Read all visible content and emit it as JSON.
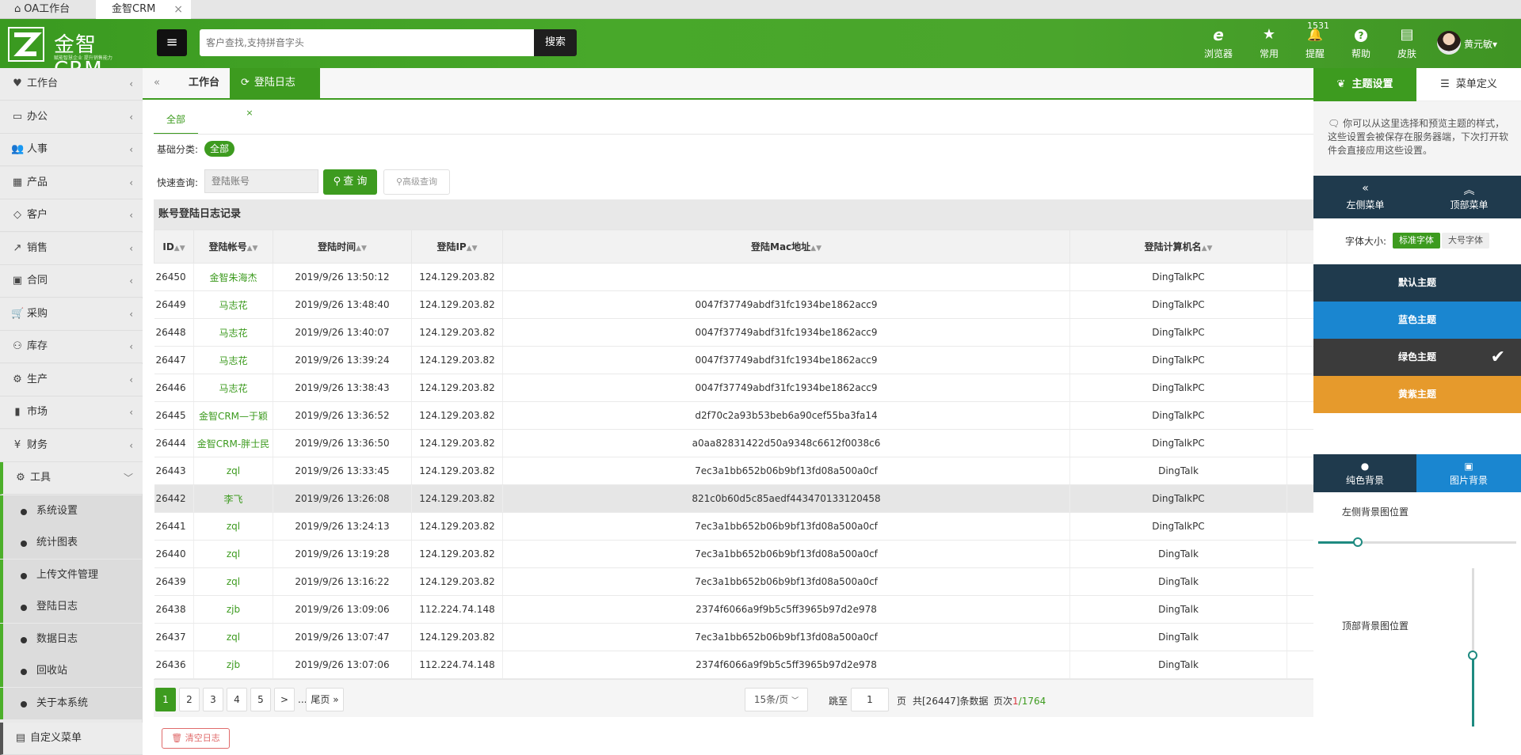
{
  "browser": {
    "tabs": [
      {
        "label": "OA工作台",
        "icon": "home-icon"
      },
      {
        "label": "金智CRM",
        "close": "×"
      }
    ]
  },
  "header": {
    "brand": "金智CRM",
    "slogan": "赋能智慧企业 提升销售能力",
    "search_placeholder": "客户查找,支持拼音字头",
    "search_button": "搜索",
    "icons": [
      {
        "name": "browser",
        "label": "浏览器",
        "glyph": "e"
      },
      {
        "name": "favorites",
        "label": "常用",
        "glyph": "★"
      },
      {
        "name": "reminder",
        "label": "提醒",
        "glyph": "🔔",
        "badge": "1531"
      },
      {
        "name": "help",
        "label": "帮助",
        "glyph": "?"
      },
      {
        "name": "skin",
        "label": "皮肤",
        "glyph": "▤"
      }
    ],
    "user": {
      "name": "黄元敏",
      "caret": "▾"
    }
  },
  "sidebar": {
    "items": [
      {
        "label": "工作台",
        "icon": "♥"
      },
      {
        "label": "办公",
        "icon": "▭"
      },
      {
        "label": "人事",
        "icon": "👥"
      },
      {
        "label": "产品",
        "icon": "▦"
      },
      {
        "label": "客户",
        "icon": "◇"
      },
      {
        "label": "销售",
        "icon": "↗"
      },
      {
        "label": "合同",
        "icon": "▣"
      },
      {
        "label": "采购",
        "icon": "🛒"
      },
      {
        "label": "库存",
        "icon": "⚇"
      },
      {
        "label": "生产",
        "icon": "⚙"
      },
      {
        "label": "市场",
        "icon": "▮"
      },
      {
        "label": "财务",
        "icon": "¥"
      },
      {
        "label": "工具",
        "icon": "⚙",
        "open": true
      }
    ],
    "subitems": [
      "系统设置",
      "统计图表",
      "上传文件管理",
      "登陆日志",
      "数据日志",
      "回收站",
      "关于本系统"
    ],
    "bottom": {
      "label": "自定义菜单",
      "icon": "▤"
    }
  },
  "pagetabs": {
    "back": "«",
    "tabs": [
      {
        "label": "工作台"
      },
      {
        "label": "登陆日志",
        "active": true,
        "refresh": "⟳",
        "close": "×"
      }
    ]
  },
  "filters": {
    "subtab": "全部",
    "category_label": "基础分类:",
    "category_value": "全部",
    "quick_label": "快速查询:",
    "quick_placeholder": "登陆账号",
    "query_button": "查 询",
    "advanced_button": "高级查询"
  },
  "table": {
    "title": "账号登陆日志记录",
    "columns": [
      "ID",
      "登陆帐号",
      "登陆时间",
      "登陆IP",
      "登陆Mac地址",
      "登陆计算机名"
    ],
    "rows": [
      [
        "26450",
        "金智朱海杰",
        "2019/9/26 13:50:12",
        "124.129.203.82",
        "",
        "DingTalkPC"
      ],
      [
        "26449",
        "马志花",
        "2019/9/26 13:48:40",
        "124.129.203.82",
        "0047f37749abdf31fc1934be1862acc9",
        "DingTalkPC"
      ],
      [
        "26448",
        "马志花",
        "2019/9/26 13:40:07",
        "124.129.203.82",
        "0047f37749abdf31fc1934be1862acc9",
        "DingTalkPC"
      ],
      [
        "26447",
        "马志花",
        "2019/9/26 13:39:24",
        "124.129.203.82",
        "0047f37749abdf31fc1934be1862acc9",
        "DingTalkPC"
      ],
      [
        "26446",
        "马志花",
        "2019/9/26 13:38:43",
        "124.129.203.82",
        "0047f37749abdf31fc1934be1862acc9",
        "DingTalkPC"
      ],
      [
        "26445",
        "金智CRM—于颖",
        "2019/9/26 13:36:52",
        "124.129.203.82",
        "d2f70c2a93b53beb6a90cef55ba3fa14",
        "DingTalkPC"
      ],
      [
        "26444",
        "金智CRM-胖士民",
        "2019/9/26 13:36:50",
        "124.129.203.82",
        "a0aa82831422d50a9348c6612f0038c6",
        "DingTalkPC"
      ],
      [
        "26443",
        "zql",
        "2019/9/26 13:33:45",
        "124.129.203.82",
        "7ec3a1bb652b06b9bf13fd08a500a0cf",
        "DingTalk"
      ],
      [
        "26442",
        "李飞",
        "2019/9/26 13:26:08",
        "124.129.203.82",
        "821c0b60d5c85aedf443470133120458",
        "DingTalkPC"
      ],
      [
        "26441",
        "zql",
        "2019/9/26 13:24:13",
        "124.129.203.82",
        "7ec3a1bb652b06b9bf13fd08a500a0cf",
        "DingTalkPC"
      ],
      [
        "26440",
        "zql",
        "2019/9/26 13:19:28",
        "124.129.203.82",
        "7ec3a1bb652b06b9bf13fd08a500a0cf",
        "DingTalk"
      ],
      [
        "26439",
        "zql",
        "2019/9/26 13:16:22",
        "124.129.203.82",
        "7ec3a1bb652b06b9bf13fd08a500a0cf",
        "DingTalk"
      ],
      [
        "26438",
        "zjb",
        "2019/9/26 13:09:06",
        "112.224.74.148",
        "2374f6066a9f9b5c5ff3965b97d2e978",
        "DingTalk"
      ],
      [
        "26437",
        "zql",
        "2019/9/26 13:07:47",
        "124.129.203.82",
        "7ec3a1bb652b06b9bf13fd08a500a0cf",
        "DingTalk"
      ],
      [
        "26436",
        "zjb",
        "2019/9/26 13:07:06",
        "112.224.74.148",
        "2374f6066a9f9b5c5ff3965b97d2e978",
        "DingTalk"
      ]
    ],
    "highlight_row": 8
  },
  "pager": {
    "pages": [
      "1",
      "2",
      "3",
      "4",
      "5"
    ],
    "next": ">",
    "ellipsis": "...",
    "last": "尾页 »",
    "page_size": "15条/页",
    "jump_label": "跳至",
    "jump_value": "1",
    "page_unit": "页",
    "total": "共[26447]条数据",
    "page_info_label": "页次",
    "current_page": "1",
    "total_pages": "/1764"
  },
  "clear_button": "清空日志",
  "right_panel": {
    "tabs": [
      {
        "label": "主题设置",
        "icon": "leaf-icon"
      },
      {
        "label": "菜单定义",
        "icon": "sliders-icon"
      }
    ],
    "description": "你可以从这里选择和预览主题的样式，这些设置会被保存在服务器端，下次打开软件会直接应用这些设置。",
    "nav": [
      {
        "label": "左侧菜单",
        "glyph": "«"
      },
      {
        "label": "顶部菜单",
        "glyph": "︽"
      }
    ],
    "font_label": "字体大小:",
    "font_options": [
      "标准字体",
      "大号字体"
    ],
    "themes": [
      {
        "label": "默认主题",
        "color": "#1f3a4d"
      },
      {
        "label": "蓝色主题",
        "color": "#1a86d0"
      },
      {
        "label": "绿色主题",
        "color": "#3b3b3b",
        "selected": true
      },
      {
        "label": "黄紫主题",
        "color": "#e69a2c"
      }
    ],
    "check": "✔",
    "bg_options": [
      {
        "label": "纯色背景",
        "glyph": "●"
      },
      {
        "label": "图片背景",
        "glyph": "▣"
      }
    ],
    "left_bg_label": "左侧背景图位置",
    "left_bg_value": 0.2,
    "top_bg_label": "顶部背景图位置",
    "top_bg_value": 0.45
  }
}
